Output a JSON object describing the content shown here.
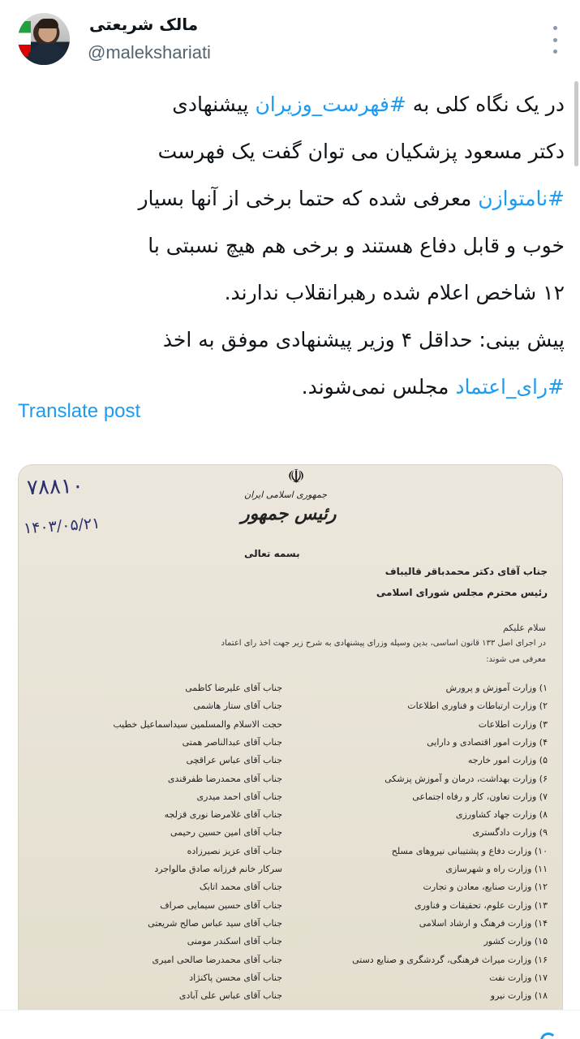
{
  "author": {
    "name": "مالک شریعتی",
    "handle": "@malekshariati"
  },
  "tweet": {
    "lines": [
      [
        {
          "t": "در یک نگاه کلی به ",
          "h": false
        },
        {
          "t": "#فهرست_وزیران",
          "h": true
        },
        {
          "t": " پیشنهادی",
          "h": false
        }
      ],
      [
        {
          "t": "دکتر مسعود پزشکیان می توان گفت یک فهرست",
          "h": false
        }
      ],
      [
        {
          "t": "#نامتوازن",
          "h": true
        },
        {
          "t": " معرفی شده که حتما برخی از آنها بسیار",
          "h": false
        }
      ],
      [
        {
          "t": "خوب و قابل دفاع هستند و برخی هم هیچ نسبتی با",
          "h": false
        }
      ],
      [
        {
          "t": "۱۲ شاخص اعلام شده رهبرانقلاب ندارند.",
          "h": false
        }
      ],
      [
        {
          "t": "پیش بینی: حداقل ۴ وزیر پیشنهادی موفق به اخذ",
          "h": false
        }
      ],
      [
        {
          "t": "#رای_اعتماد",
          "h": true
        },
        {
          "t": " مجلس نمی‌شوند.",
          "h": false
        }
      ]
    ]
  },
  "translate_label": "Translate post",
  "document": {
    "emblem": "☫",
    "ref_number": "۷۸۸۱۰",
    "ref_date": "۱۴۰۳/۰۵/۲۱",
    "org_line1": "جمهوری اسلامی ایران",
    "org_line2": "رئیس جمهور",
    "basmala": "بسمه تعالی",
    "addressee_line1": "جناب آقای دکتر محمدباقر قالیباف",
    "addressee_line2": "رئیس محترم مجلس شورای اسلامی",
    "greeting": "سلام علیکم",
    "intro_line1": "در اجرای اصل ۱۳۳ قانون اساسی، بدین وسیله وزرای پیشنهادی به شرح زیر جهت اخذ رای اعتماد",
    "intro_line2": "معرفی می شوند:",
    "rows": [
      {
        "ministry": "۱) وزارت آموزش و پرورش",
        "minister": "جناب آقای علیرضا کاظمی"
      },
      {
        "ministry": "۲) وزارت ارتباطات و فناوری اطلاعات",
        "minister": "جناب آقای ستار هاشمی"
      },
      {
        "ministry": "۳) وزارت اطلاعات",
        "minister": "حجت الاسلام والمسلمین سیداسماعیل خطیب"
      },
      {
        "ministry": "۴) وزارت امور اقتصادی و دارایی",
        "minister": "جناب آقای عبدالناصر همتی"
      },
      {
        "ministry": "۵) وزارت امور خارجه",
        "minister": "جناب آقای عباس عراقچی"
      },
      {
        "ministry": "۶) وزارت بهداشت، درمان و آموزش پزشکی",
        "minister": "جناب آقای محمدرضا ظفرقندی"
      },
      {
        "ministry": "۷) وزارت تعاون، کار و رفاه اجتماعی",
        "minister": "جناب آقای احمد میدری"
      },
      {
        "ministry": "۸) وزارت جهاد کشاورزی",
        "minister": "جناب آقای غلامرضا نوری قزلجه"
      },
      {
        "ministry": "۹) وزارت دادگستری",
        "minister": "جناب آقای امین حسین رحیمی"
      },
      {
        "ministry": "۱۰) وزارت دفاع و پشتیبانی نیروهای مسلح",
        "minister": "جناب آقای عزیز نصیرزاده"
      },
      {
        "ministry": "۱۱) وزارت راه و شهرسازی",
        "minister": "سرکار خانم فرزانه صادق مالواجرد"
      },
      {
        "ministry": "۱۲) وزارت صنایع، معادن و تجارت",
        "minister": "جناب آقای محمد اتابک"
      },
      {
        "ministry": "۱۳) وزارت علوم، تحقیقات و فناوری",
        "minister": "جناب آقای حسین سیمایی صراف"
      },
      {
        "ministry": "۱۴) وزارت فرهنگ و ارشاد اسلامی",
        "minister": "جناب آقای سید عباس صالح شریعتی"
      },
      {
        "ministry": "۱۵) وزارت کشور",
        "minister": "جناب آقای اسکندر مومنی"
      },
      {
        "ministry": "۱۶) وزارت میراث فرهنگی، گردشگری و صنایع دستی",
        "minister": "جناب آقای محمدرضا صالحی امیری"
      },
      {
        "ministry": "۱۷) وزارت نفت",
        "minister": "جناب آقای محسن پاکنژاد"
      },
      {
        "ministry": "۱۸) وزارت نیرو",
        "minister": "جناب آقای عباس علی آبادی"
      }
    ]
  }
}
